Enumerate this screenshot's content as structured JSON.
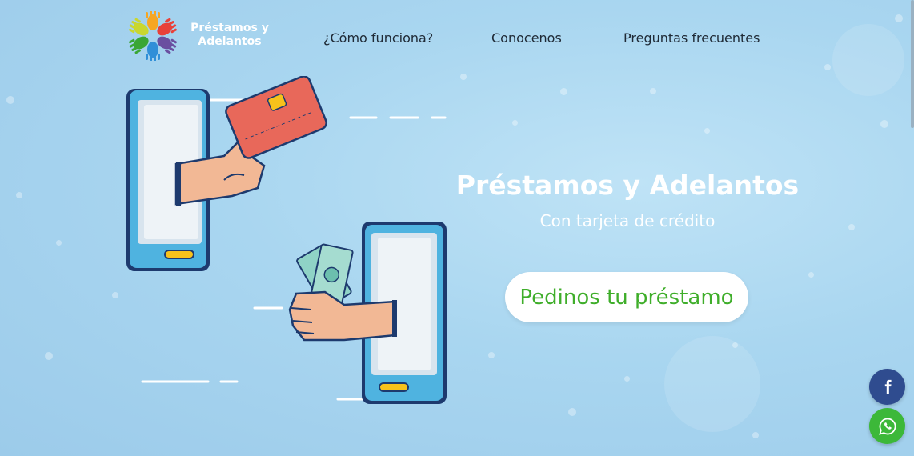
{
  "brand": {
    "line1": "Préstamos y",
    "line2": "Adelantos",
    "logo_icon": "colorful-hands-logo"
  },
  "nav": {
    "items": [
      {
        "label": "¿Cómo funciona?"
      },
      {
        "label": "Conocenos"
      },
      {
        "label": "Preguntas frecuentes"
      }
    ]
  },
  "hero": {
    "title": "Préstamos y Adelantos",
    "subtitle": "Con tarjeta de crédito",
    "cta_label": "Pedinos tu préstamo"
  },
  "social": {
    "facebook_icon": "facebook-icon",
    "whatsapp_icon": "whatsapp-icon"
  },
  "colors": {
    "cta_text": "#3fae2a",
    "facebook": "#2f4c8f",
    "whatsapp": "#3cb839",
    "nav_text": "#1f2a36"
  }
}
